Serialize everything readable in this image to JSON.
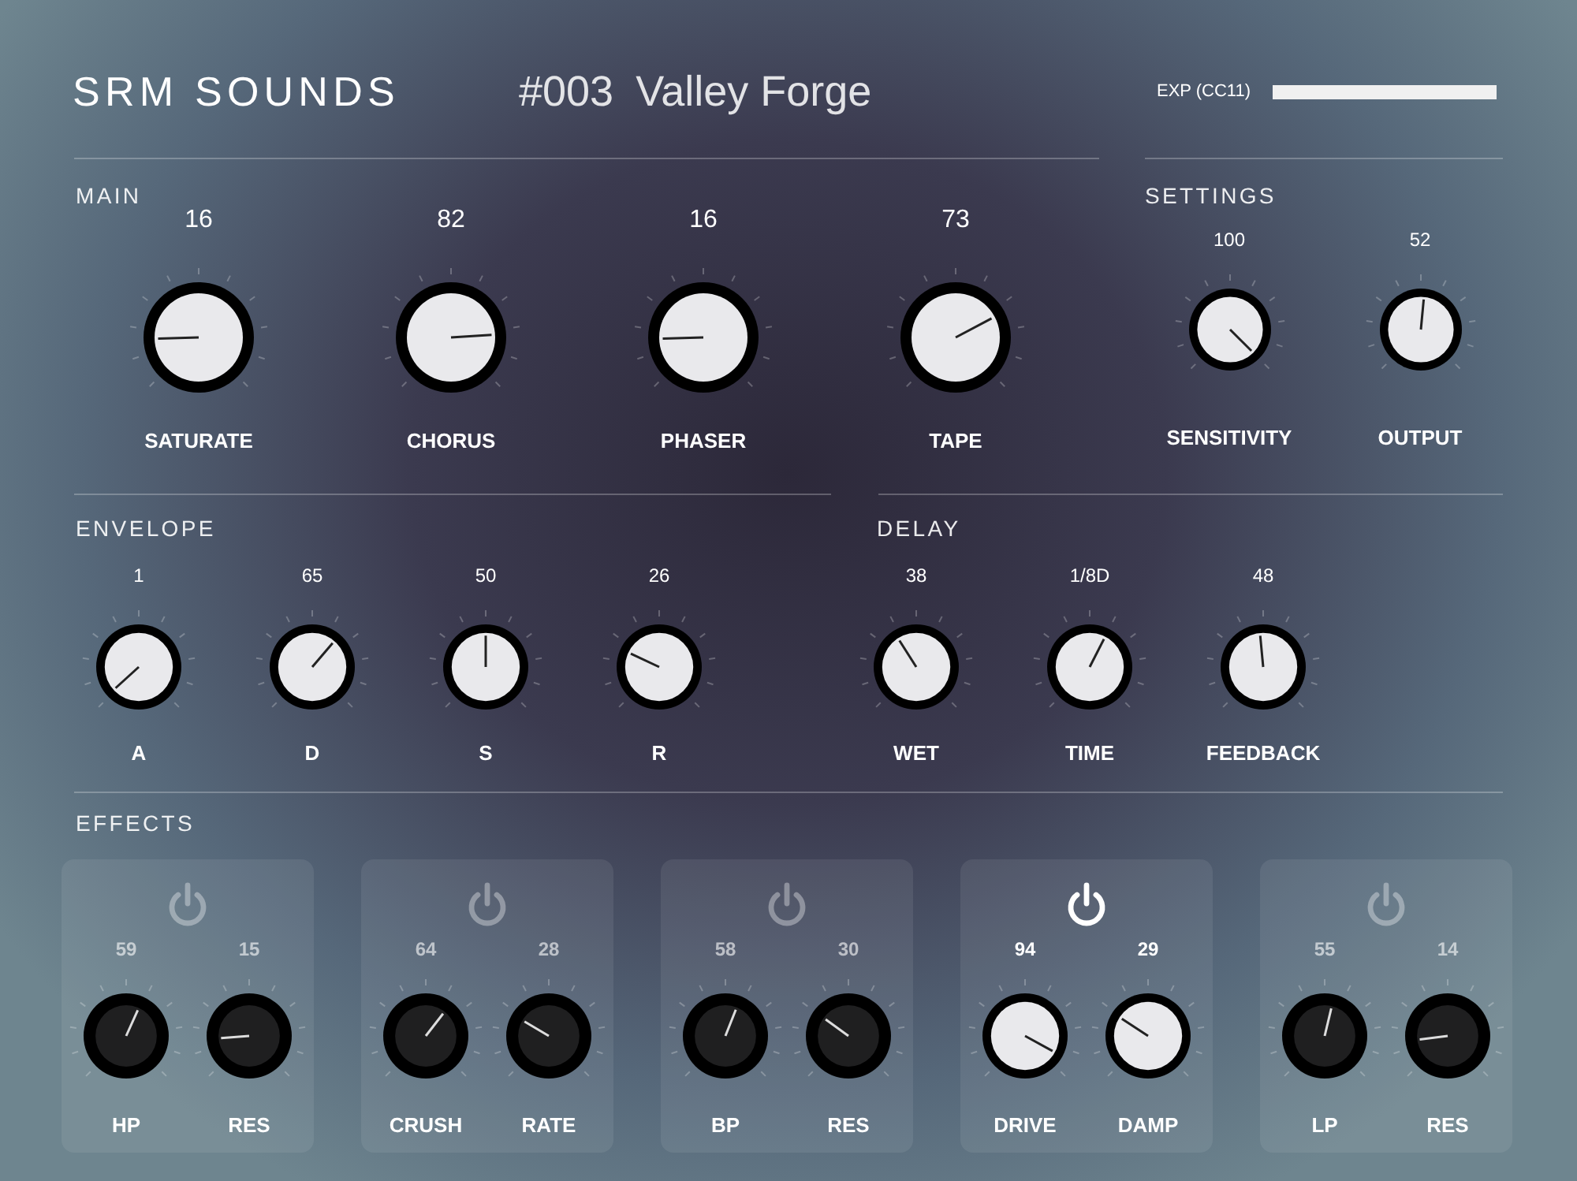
{
  "header": {
    "brand": "SRM SOUNDS",
    "preset_number": "#003",
    "preset_name": "Valley Forge",
    "expression": {
      "label": "EXP (CC11)",
      "level": 1
    }
  },
  "main": {
    "title": "MAIN",
    "knobs": [
      {
        "label": "SATURATE",
        "value": "16"
      },
      {
        "label": "CHORUS",
        "value": "82"
      },
      {
        "label": "PHASER",
        "value": "16"
      },
      {
        "label": "TAPE",
        "value": "73"
      }
    ]
  },
  "settings": {
    "title": "SETTINGS",
    "knobs": [
      {
        "label": "SENSITIVITY",
        "value": "100"
      },
      {
        "label": "OUTPUT",
        "value": "52"
      }
    ]
  },
  "envelope": {
    "title": "ENVELOPE",
    "knobs": [
      {
        "label": "A",
        "value": "1"
      },
      {
        "label": "D",
        "value": "65"
      },
      {
        "label": "S",
        "value": "50"
      },
      {
        "label": "R",
        "value": "26"
      }
    ]
  },
  "delay": {
    "title": "DELAY",
    "knobs": [
      {
        "label": "WET",
        "value": "38"
      },
      {
        "label": "TIME",
        "value": "1/8D"
      },
      {
        "label": "FEEDBACK",
        "value": "48"
      }
    ]
  },
  "effects": {
    "title": "EFFECTS",
    "units": [
      {
        "on": false,
        "knobs": [
          {
            "label": "HP",
            "value": "59"
          },
          {
            "label": "RES",
            "value": "15"
          }
        ]
      },
      {
        "on": false,
        "knobs": [
          {
            "label": "CRUSH",
            "value": "64"
          },
          {
            "label": "RATE",
            "value": "28"
          }
        ]
      },
      {
        "on": false,
        "knobs": [
          {
            "label": "BP",
            "value": "58"
          },
          {
            "label": "RES",
            "value": "30"
          }
        ]
      },
      {
        "on": true,
        "knobs": [
          {
            "label": "DRIVE",
            "value": "94"
          },
          {
            "label": "DAMP",
            "value": "29"
          }
        ]
      },
      {
        "on": false,
        "knobs": [
          {
            "label": "LP",
            "value": "55"
          },
          {
            "label": "RES",
            "value": "14"
          }
        ]
      }
    ]
  }
}
